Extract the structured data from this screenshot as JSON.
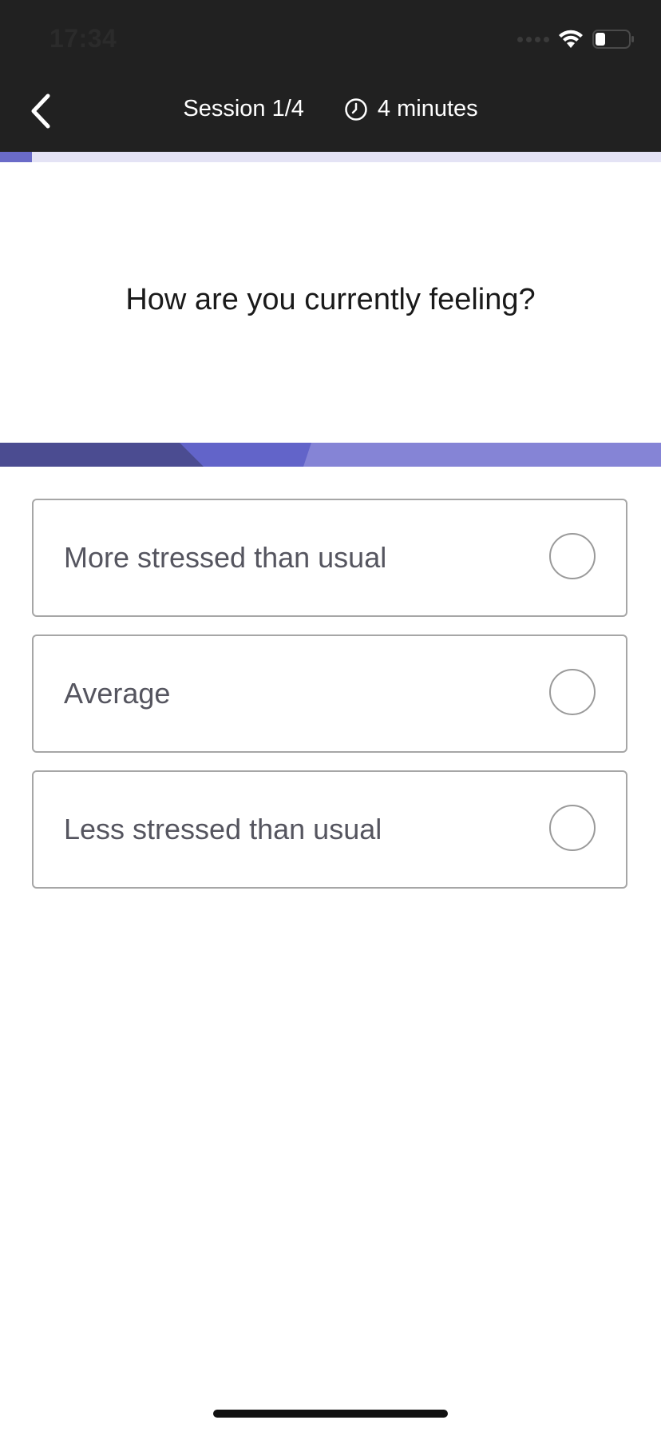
{
  "status_bar": {
    "time": "17:34",
    "battery_level": 0.3
  },
  "header": {
    "session": "Session 1/4",
    "duration": "4 minutes",
    "icons": [
      "back-chevron-icon",
      "clock-icon",
      "wifi-icon",
      "battery-icon"
    ]
  },
  "progress": {
    "fraction": 0.048
  },
  "question": "How are you currently feeling?",
  "options": [
    {
      "label": "More stressed than usual",
      "selected": false
    },
    {
      "label": "Average",
      "selected": false
    },
    {
      "label": "Less stressed than usual",
      "selected": false
    }
  ],
  "colors": {
    "header_bg": "#212121",
    "accent": "#6a6bc8",
    "track": "#e4e3f5",
    "band_dark": "#4b4c91",
    "band_mid": "#6264c9",
    "band_light": "#8584d6"
  }
}
